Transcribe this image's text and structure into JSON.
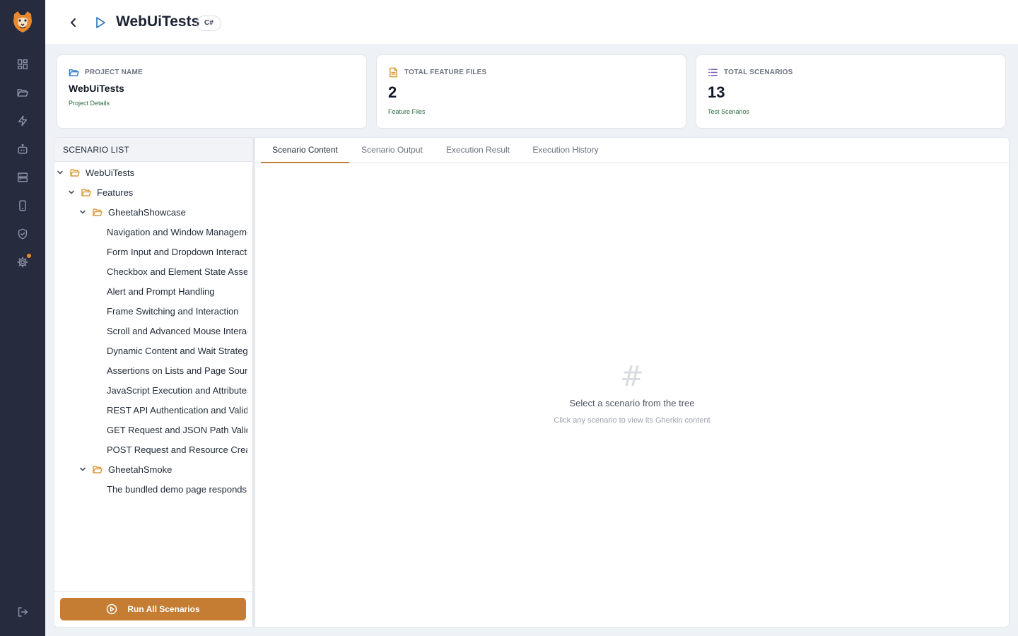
{
  "app": {
    "nav_icons": [
      "dashboard-icon",
      "folder-icon",
      "lightning-icon",
      "robot-icon",
      "server-icon",
      "mobile-icon",
      "shield-check-icon",
      "gear-icon"
    ],
    "logout_icon": "logout-icon",
    "settings_badge_color": "#e7892f",
    "accent_color": "#c47d33"
  },
  "header": {
    "title": "WebUiTests",
    "language_badge": "C#"
  },
  "cards": {
    "project": {
      "label": "PROJECT NAME",
      "value": "WebUiTests",
      "sub": "Project Details",
      "icon": "folder-open-icon"
    },
    "feature_files": {
      "label": "TOTAL FEATURE FILES",
      "value": "2",
      "sub": "Feature Files",
      "icon": "file-icon"
    },
    "scenarios": {
      "label": "TOTAL SCENARIOS",
      "value": "13",
      "sub": "Test Scenarios",
      "icon": "list-icon"
    }
  },
  "scenario_list": {
    "title": "SCENARIO LIST",
    "tree": [
      {
        "label": "WebUiTests",
        "type": "folder",
        "expanded": true,
        "level": 0
      },
      {
        "label": "Features",
        "type": "folder",
        "expanded": true,
        "level": 1
      },
      {
        "label": "GheetahShowcase",
        "type": "folder",
        "expanded": true,
        "level": 2
      },
      {
        "label": "Navigation and Window Management",
        "type": "scenario",
        "level": 3
      },
      {
        "label": "Form Input and Dropdown Interaction",
        "type": "scenario",
        "level": 3
      },
      {
        "label": "Checkbox and Element State Assertions",
        "type": "scenario",
        "level": 3
      },
      {
        "label": "Alert and Prompt Handling",
        "type": "scenario",
        "level": 3
      },
      {
        "label": "Frame Switching and Interaction",
        "type": "scenario",
        "level": 3
      },
      {
        "label": "Scroll and Advanced Mouse Interaction",
        "type": "scenario",
        "level": 3
      },
      {
        "label": "Dynamic Content and Wait Strategies",
        "type": "scenario",
        "level": 3
      },
      {
        "label": "Assertions on Lists and Page Source",
        "type": "scenario",
        "level": 3
      },
      {
        "label": "JavaScript Execution and Attributes",
        "type": "scenario",
        "level": 3
      },
      {
        "label": "REST API Authentication and Validation",
        "type": "scenario",
        "level": 3
      },
      {
        "label": "GET Request and JSON Path Validation",
        "type": "scenario",
        "level": 3
      },
      {
        "label": "POST Request and Resource Creation",
        "type": "scenario",
        "level": 3
      },
      {
        "label": "GheetahSmoke",
        "type": "folder",
        "expanded": true,
        "level": 2
      },
      {
        "label": "The bundled demo page responds",
        "type": "scenario",
        "level": 3
      }
    ],
    "run_all_label": "Run All Scenarios"
  },
  "content": {
    "tabs": [
      {
        "label": "Scenario Content",
        "active": true
      },
      {
        "label": "Scenario Output",
        "active": false
      },
      {
        "label": "Execution Result",
        "active": false
      },
      {
        "label": "Execution History",
        "active": false
      }
    ],
    "empty_icon": "#",
    "empty_title": "Select a scenario from the tree",
    "empty_subtitle": "Click any scenario to view its Gherkin content"
  }
}
